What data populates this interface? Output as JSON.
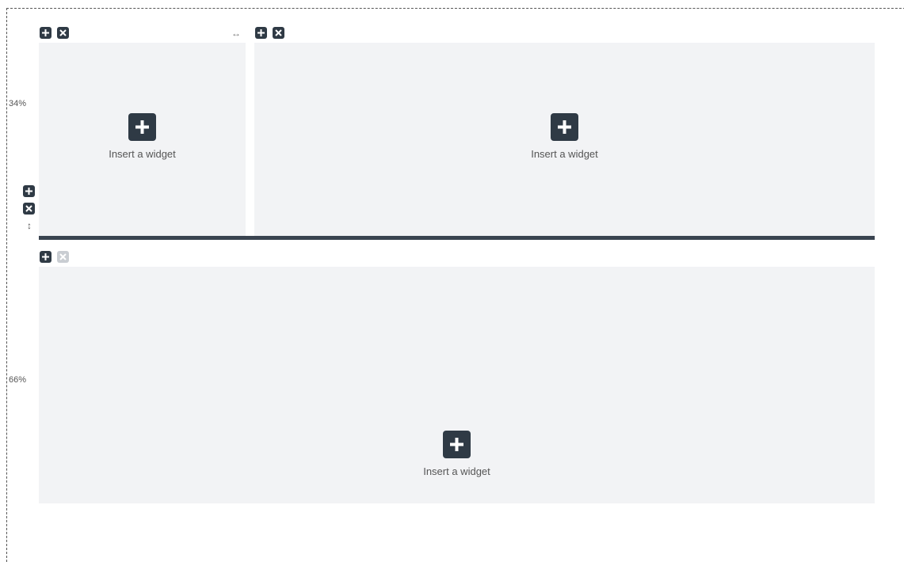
{
  "rows": [
    {
      "height_label": "34%",
      "columns": [
        {
          "insert_label": "Insert a widget",
          "icon": "plus-icon",
          "delete_enabled": true
        },
        {
          "insert_label": "Insert a widget",
          "icon": "plus-icon",
          "delete_enabled": true
        }
      ],
      "row_controls": {
        "add_icon": "plus-icon",
        "delete_icon": "close-icon",
        "resize_icon": "vertical-resize-icon"
      },
      "column_resize_icon": "horizontal-resize-icon"
    },
    {
      "height_label": "66%",
      "columns": [
        {
          "insert_label": "Insert a widget",
          "icon": "plus-icon",
          "delete_enabled": false
        }
      ]
    }
  ],
  "colors": {
    "control_dark": "#2f3a45",
    "control_disabled": "#c9cdd2",
    "panel_bg": "#f2f3f5",
    "divider": "#3a4450"
  }
}
